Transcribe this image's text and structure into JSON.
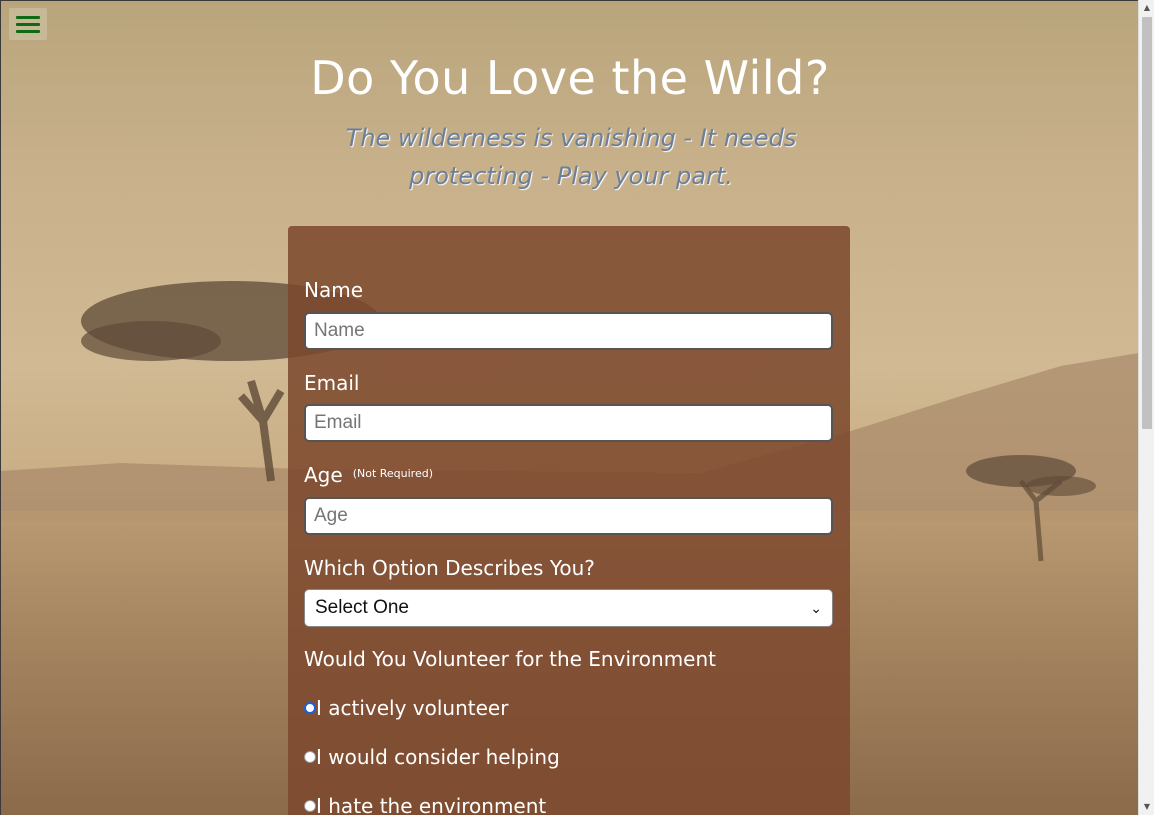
{
  "header": {
    "title": "Do You Love the Wild?",
    "subtitle": "The wilderness is vanishing - It needs protecting - Play your part."
  },
  "menu": {
    "icon": "hamburger-menu-icon",
    "color": "#0e6b12"
  },
  "form": {
    "name_label": "Name",
    "name_placeholder": "Name",
    "email_label": "Email",
    "email_placeholder": "Email",
    "age_label": "Age",
    "age_note": "(Not Required)",
    "age_placeholder": "Age",
    "option_label": "Which Option Describes You?",
    "option_selected": "Select One",
    "volunteer_label": "Would You Volunteer for the Environment",
    "radios": [
      {
        "label": "I actively volunteer",
        "checked": true
      },
      {
        "label": "I would consider helping",
        "checked": false
      },
      {
        "label": "I hate the environment",
        "checked": false
      }
    ]
  },
  "colors": {
    "card": "#7d482d",
    "subtitle": "#6b7f99",
    "radio_checked": "#1a5fe0"
  }
}
